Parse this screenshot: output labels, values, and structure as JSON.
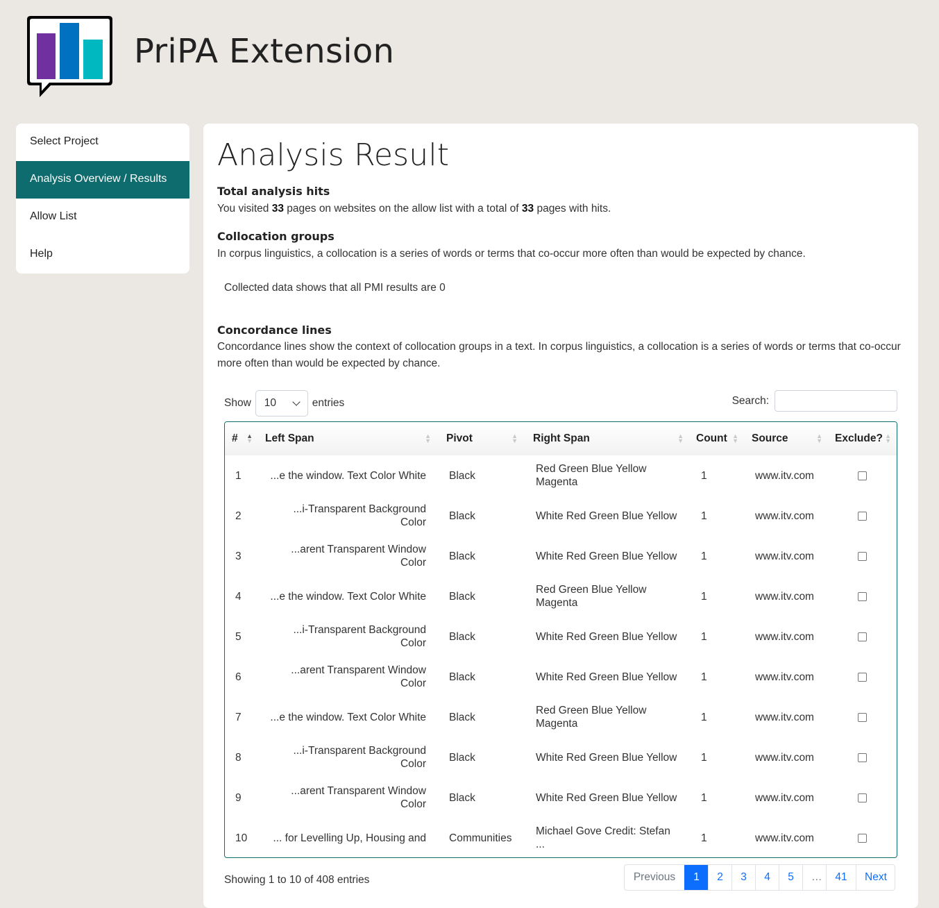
{
  "app": {
    "title": "PriPA Extension"
  },
  "sidebar": {
    "items": [
      {
        "label": "Select Project",
        "active": false
      },
      {
        "label": "Analysis Overview / Results",
        "active": true
      },
      {
        "label": "Allow List",
        "active": false
      },
      {
        "label": "Help",
        "active": false
      }
    ]
  },
  "main": {
    "title": "Analysis Result",
    "hits": {
      "heading": "Total analysis hits",
      "text_1": "You visited ",
      "visited": "33",
      "text_2": " pages on websites on the allow list with a total of ",
      "total": "33",
      "text_3": " pages with hits."
    },
    "collocation": {
      "heading": "Collocation groups",
      "text": "In corpus linguistics, a collocation is a series of words or terms that co-occur more often than would be expected by chance.",
      "pmi_note": "Collected data shows that all PMI results are 0"
    },
    "concordance": {
      "heading": "Concordance lines",
      "text": "Concordance lines show the context of collocation groups in a text. In corpus linguistics, a collocation is a series of words or terms that co-occur more often than would be expected by chance."
    }
  },
  "table_controls": {
    "show_label": "Show",
    "page_length": "10",
    "entries_label": "entries",
    "search_label": "Search:",
    "search_value": ""
  },
  "table": {
    "columns": [
      "#",
      "Left Span",
      "Pivot",
      "Right Span",
      "Count",
      "Source",
      "Exclude?"
    ],
    "sorted_column": "#",
    "rows": [
      {
        "num": "1",
        "left": "...e the window. Text Color White",
        "pivot": "Black",
        "right": "Red Green Blue Yellow Magenta",
        "count": "1",
        "source": "www.itv.com",
        "exclude": false
      },
      {
        "num": "2",
        "left": "...i-Transparent Background Color",
        "pivot": "Black",
        "right": "White Red Green Blue Yellow",
        "count": "1",
        "source": "www.itv.com",
        "exclude": false
      },
      {
        "num": "3",
        "left": "...arent Transparent Window Color",
        "pivot": "Black",
        "right": "White Red Green Blue Yellow",
        "count": "1",
        "source": "www.itv.com",
        "exclude": false
      },
      {
        "num": "4",
        "left": "...e the window. Text Color White",
        "pivot": "Black",
        "right": "Red Green Blue Yellow Magenta",
        "count": "1",
        "source": "www.itv.com",
        "exclude": false
      },
      {
        "num": "5",
        "left": "...i-Transparent Background Color",
        "pivot": "Black",
        "right": "White Red Green Blue Yellow",
        "count": "1",
        "source": "www.itv.com",
        "exclude": false
      },
      {
        "num": "6",
        "left": "...arent Transparent Window Color",
        "pivot": "Black",
        "right": "White Red Green Blue Yellow",
        "count": "1",
        "source": "www.itv.com",
        "exclude": false
      },
      {
        "num": "7",
        "left": "...e the window. Text Color White",
        "pivot": "Black",
        "right": "Red Green Blue Yellow Magenta",
        "count": "1",
        "source": "www.itv.com",
        "exclude": false
      },
      {
        "num": "8",
        "left": "...i-Transparent Background Color",
        "pivot": "Black",
        "right": "White Red Green Blue Yellow",
        "count": "1",
        "source": "www.itv.com",
        "exclude": false
      },
      {
        "num": "9",
        "left": "...arent Transparent Window Color",
        "pivot": "Black",
        "right": "White Red Green Blue Yellow",
        "count": "1",
        "source": "www.itv.com",
        "exclude": false
      },
      {
        "num": "10",
        "left": "... for Levelling Up, Housing and",
        "pivot": "Communities",
        "right": "Michael Gove Credit: Stefan ...",
        "count": "1",
        "source": "www.itv.com",
        "exclude": false
      }
    ]
  },
  "footer": {
    "info": "Showing 1 to 10 of 408 entries",
    "pagination": [
      {
        "label": "Previous",
        "state": "disabled"
      },
      {
        "label": "1",
        "state": "active"
      },
      {
        "label": "2",
        "state": "normal"
      },
      {
        "label": "3",
        "state": "normal"
      },
      {
        "label": "4",
        "state": "normal"
      },
      {
        "label": "5",
        "state": "normal"
      },
      {
        "label": "…",
        "state": "ellipsis"
      },
      {
        "label": "41",
        "state": "normal"
      },
      {
        "label": "Next",
        "state": "normal"
      }
    ]
  },
  "colors": {
    "accent": "#0e6b6e",
    "page_background": "#ebe8e4",
    "link": "#0d6efd",
    "logo_purple": "#7030a0",
    "logo_blue": "#0070c0",
    "logo_teal": "#00b8c0"
  },
  "icons": {
    "logo": "bar-chart-speech-bubble-icon",
    "select_chevron": "chevron-down-icon",
    "sort": "sort-arrows-icon"
  }
}
